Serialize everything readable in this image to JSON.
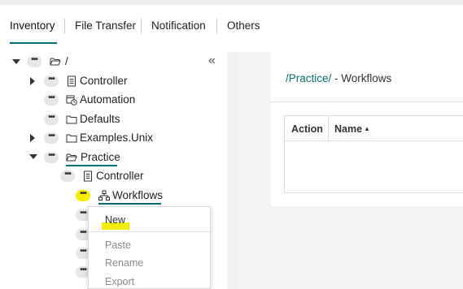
{
  "tabs": [
    {
      "label": "Inventory",
      "active": true
    },
    {
      "label": "File Transfer",
      "active": false
    },
    {
      "label": "Notification",
      "active": false
    },
    {
      "label": "Others",
      "active": false
    }
  ],
  "tree": {
    "collapse_glyph": "«",
    "dots_glyph": "•••",
    "nodes": [
      {
        "label": "/",
        "icon": "folder-open-icon",
        "expanded": true
      },
      {
        "label": "Controller",
        "icon": "controller-icon",
        "expanded": false
      },
      {
        "label": "Automation",
        "icon": "calendar-clock-icon"
      },
      {
        "label": "Defaults",
        "icon": "folder-icon"
      },
      {
        "label": "Examples.Unix",
        "icon": "folder-icon",
        "expanded": false
      },
      {
        "label": "Practice",
        "icon": "folder-open-icon",
        "expanded": true
      },
      {
        "label": "Controller",
        "icon": "controller-icon"
      },
      {
        "label": "Workflows",
        "icon": "workflow-icon"
      }
    ]
  },
  "main": {
    "breadcrumb_link": "/Practice/",
    "breadcrumb_rest": " - Workflows",
    "table": {
      "columns": [
        "Action",
        "Name"
      ],
      "sort_indicator": "▲"
    }
  },
  "context_menu": {
    "items": [
      {
        "label": "New",
        "enabled": true
      },
      {
        "label": "Paste",
        "enabled": false
      },
      {
        "label": "Rename",
        "enabled": false
      },
      {
        "label": "Export",
        "enabled": false
      }
    ]
  },
  "colors": {
    "accent": "#0b6e6e",
    "highlight": "#f5ee00"
  }
}
